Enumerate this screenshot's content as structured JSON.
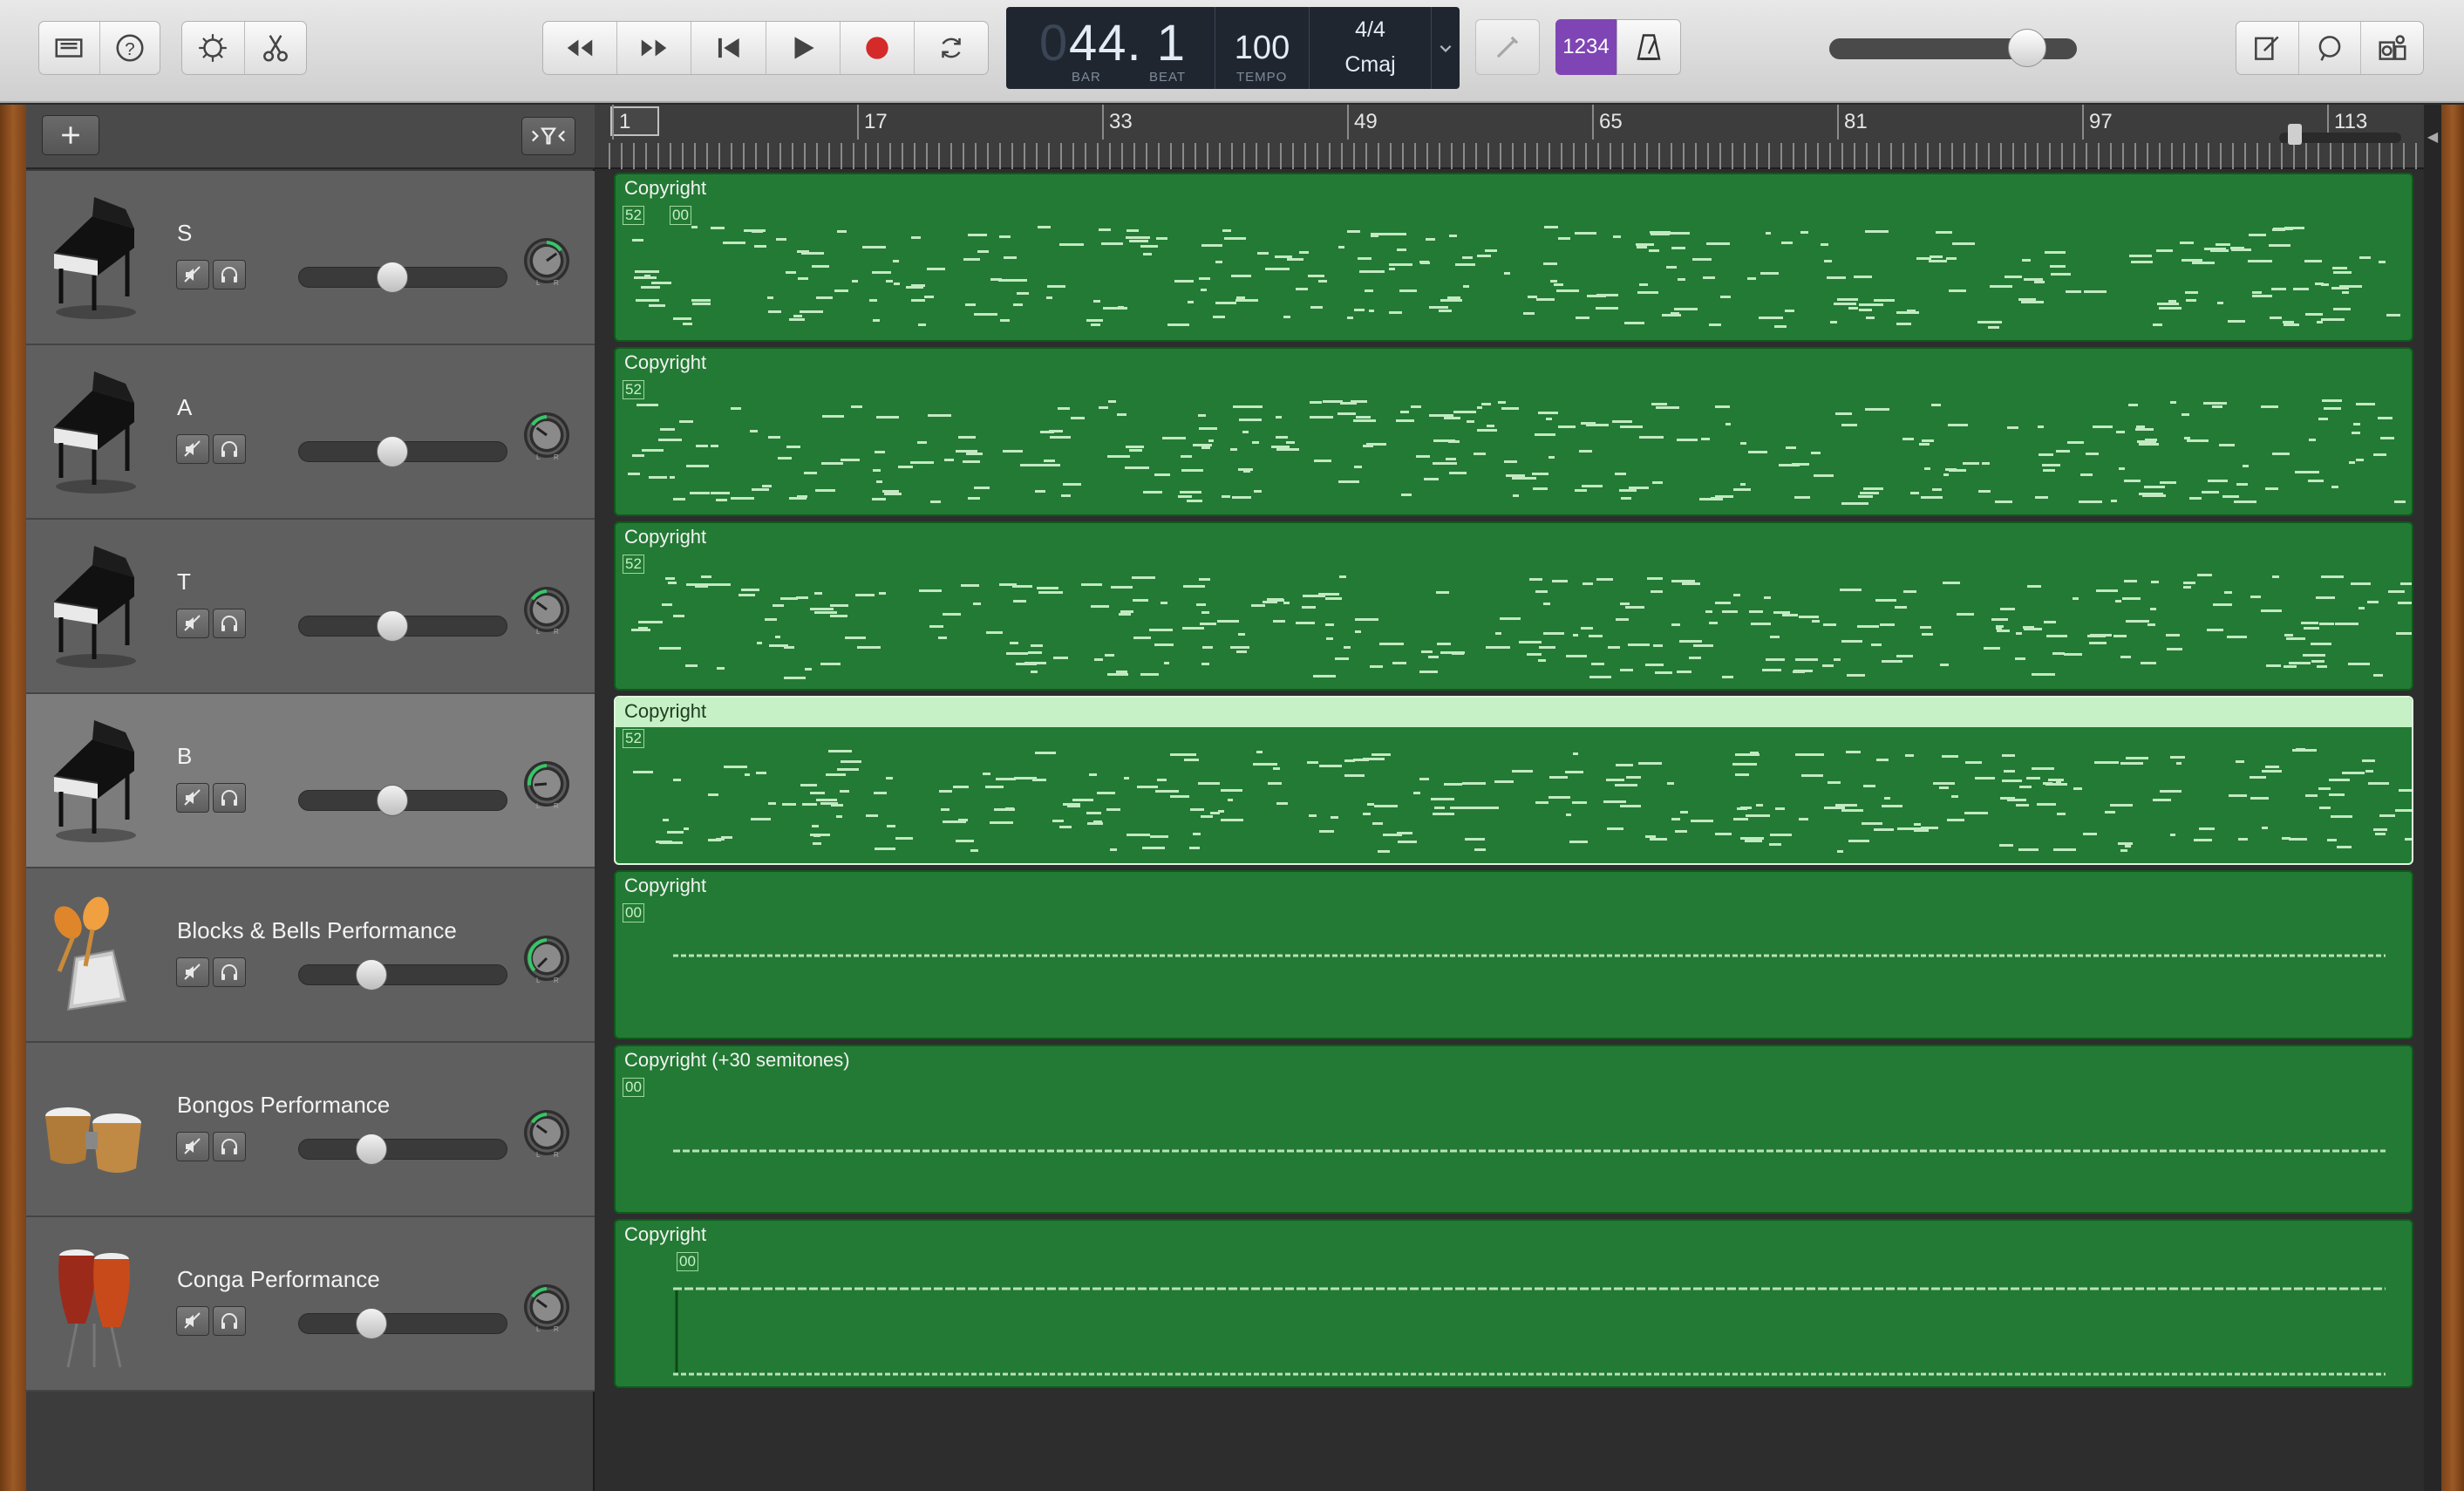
{
  "toolbar": {
    "library_icon": "library-icon",
    "help_icon": "help-icon",
    "smart_controls_icon": "smart-controls-icon",
    "editors_icon": "scissors-icon",
    "transport": [
      "rewind-icon",
      "fast-forward-icon",
      "go-to-start-icon",
      "play-icon",
      "record-icon",
      "cycle-icon"
    ],
    "right_icons": [
      "note-pad-icon",
      "loops-icon",
      "media-browser-icon"
    ]
  },
  "lcd": {
    "ghost": "0",
    "position": "44. 1",
    "bar_label": "BAR",
    "beat_label": "BEAT",
    "tempo": "100",
    "tempo_label": "TEMPO",
    "time_signature": "4/4",
    "key": "Cmaj"
  },
  "count_in": "1234",
  "master_volume": 0.8,
  "ruler": {
    "bars": [
      "1",
      "17",
      "33",
      "49",
      "65",
      "81",
      "97",
      "113"
    ]
  },
  "colors": {
    "region_green": "#237a34",
    "accent_purple": "#7f45b4",
    "pan_green": "#37c667"
  },
  "tracks": [
    {
      "name": "S",
      "icon": "grand-piano-icon",
      "region_title": "Copyright",
      "tags": [
        "52",
        "00"
      ],
      "volume": 0.45,
      "pan": 0.7
    },
    {
      "name": "A",
      "icon": "grand-piano-icon",
      "region_title": "Copyright",
      "tags": [
        "52"
      ],
      "volume": 0.45,
      "pan": 0.3
    },
    {
      "name": "T",
      "icon": "grand-piano-icon",
      "region_title": "Copyright",
      "tags": [
        "52"
      ],
      "volume": 0.45,
      "pan": 0.3
    },
    {
      "name": "B",
      "icon": "grand-piano-icon",
      "region_title": "Copyright",
      "tags": [
        "52"
      ],
      "volume": 0.45,
      "pan": 0.15
    },
    {
      "name": "Blocks & Bells Performance",
      "icon": "cowbell-icon",
      "region_title": "Copyright",
      "tags": [
        "00"
      ],
      "volume": 0.35,
      "pan": 0.0
    },
    {
      "name": "Bongos Performance",
      "icon": "bongos-icon",
      "region_title": "Copyright  (+30 semitones)",
      "tags": [
        "00"
      ],
      "volume": 0.35,
      "pan": 0.3
    },
    {
      "name": "Conga Performance",
      "icon": "conga-icon",
      "region_title": "Copyright",
      "tags": [
        "00"
      ],
      "volume": 0.35,
      "pan": 0.3
    }
  ]
}
